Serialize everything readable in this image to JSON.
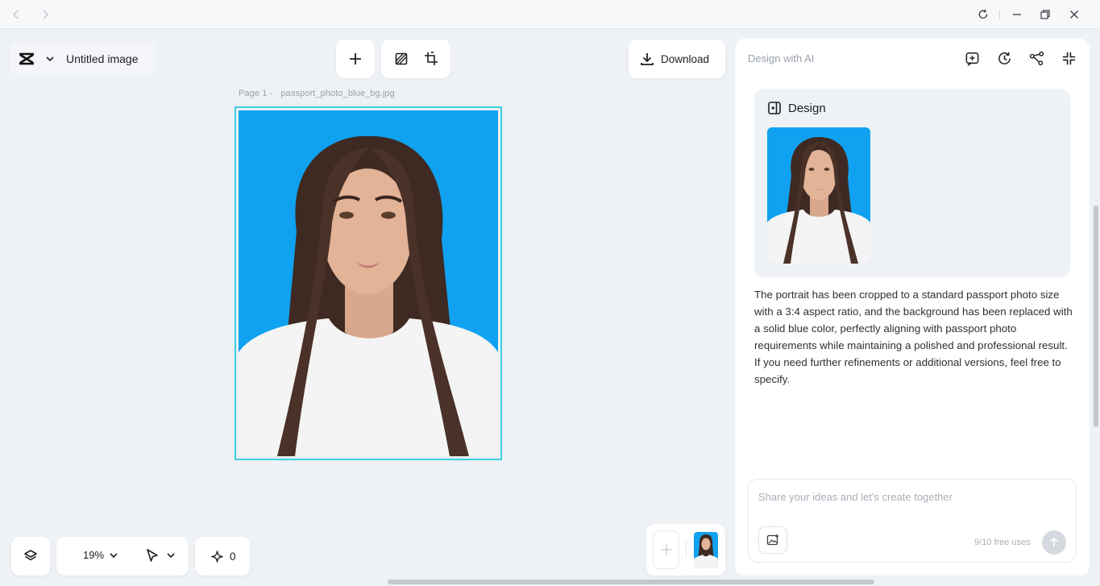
{
  "titlebar": {
    "back_icon": "chevron-left-icon",
    "forward_icon": "chevron-right-icon",
    "refresh_icon": "refresh-icon",
    "minimize_icon": "minimize-icon",
    "restore_icon": "restore-icon",
    "close_icon": "close-icon"
  },
  "brand": {
    "logo_icon": "capcut-logo-icon",
    "title": "Untitled image"
  },
  "toolbar": {
    "add_icon": "plus-icon",
    "background_icon": "background-pattern-icon",
    "resize_icon": "crop-resize-icon",
    "download_label": "Download"
  },
  "canvas": {
    "page_label": "Page 1 -",
    "file_name": "passport_photo_blue_bg.jpg",
    "background_color": "#10a2f0",
    "frame_color": "#3ccfe0"
  },
  "bottom_bar": {
    "layers_icon": "layers-icon",
    "zoom": "19%",
    "select_tool_icon": "pointer-icon",
    "credits_icon": "sparkle-icon",
    "credits": "0",
    "add_page_icon": "plus-icon"
  },
  "panel": {
    "title": "Design with AI",
    "tools": [
      "new-chat-icon",
      "history-icon",
      "share-nodes-icon",
      "collapse-icon"
    ],
    "design_card": {
      "heading": "Design",
      "heading_icon": "design-doc-icon"
    },
    "message": "The portrait has been cropped to a standard passport photo size with a 3:4 aspect ratio, and the background has been replaced with a solid blue color, perfectly aligning with passport photo requirements while maintaining a polished and professional result. If you need further refinements or additional versions, feel free to specify.",
    "composer": {
      "placeholder": "Share your ideas and let's create together",
      "value": "",
      "attach_icon": "image-upload-icon",
      "uses": "9/10 free uses",
      "send_icon": "arrow-up-icon"
    }
  },
  "colors": {
    "accent": "#3ccfe0",
    "photo_bg": "#10a2f0",
    "workspace_bg": "#eef1f5"
  }
}
